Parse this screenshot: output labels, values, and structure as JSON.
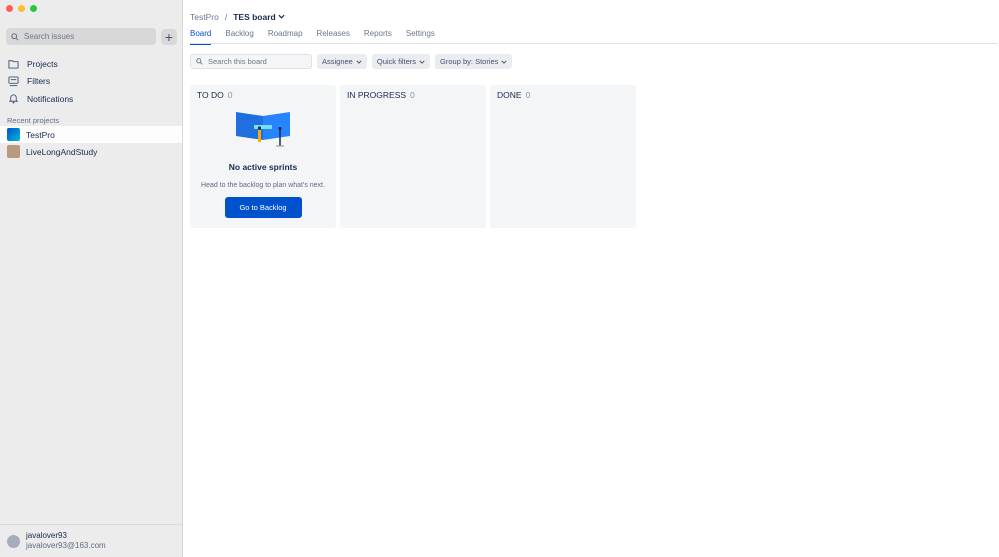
{
  "sidebar": {
    "search_placeholder": "Search issues",
    "add_label": "+",
    "nav": [
      {
        "label": "Projects",
        "icon": "projects-icon"
      },
      {
        "label": "Filters",
        "icon": "filters-icon"
      },
      {
        "label": "Notifications",
        "icon": "bell-icon"
      }
    ],
    "recent_title": "Recent projects",
    "projects": [
      {
        "label": "TestPro",
        "active": true
      },
      {
        "label": "LiveLongAndStudy",
        "active": false
      }
    ],
    "user": {
      "name": "javalover93",
      "email": "javalover93@163.com"
    }
  },
  "header": {
    "project": "TestPro",
    "separator": "/",
    "board": "TES board",
    "tabs": [
      "Board",
      "Backlog",
      "Roadmap",
      "Releases",
      "Reports",
      "Settings"
    ],
    "active_tab": "Board"
  },
  "toolbar": {
    "search_placeholder": "Search this board",
    "assignee": "Assignee",
    "quick_filters": "Quick filters",
    "group_by": "Group by: Stories"
  },
  "columns": [
    {
      "title": "TO DO",
      "count": "0"
    },
    {
      "title": "IN PROGRESS",
      "count": "0"
    },
    {
      "title": "DONE",
      "count": "0"
    }
  ],
  "empty_state": {
    "title": "No active sprints",
    "description": "Head to the backlog to plan what's next.",
    "button": "Go to Backlog"
  },
  "colors": {
    "accent": "#0052cc",
    "sidebar_bg": "#ececec"
  }
}
